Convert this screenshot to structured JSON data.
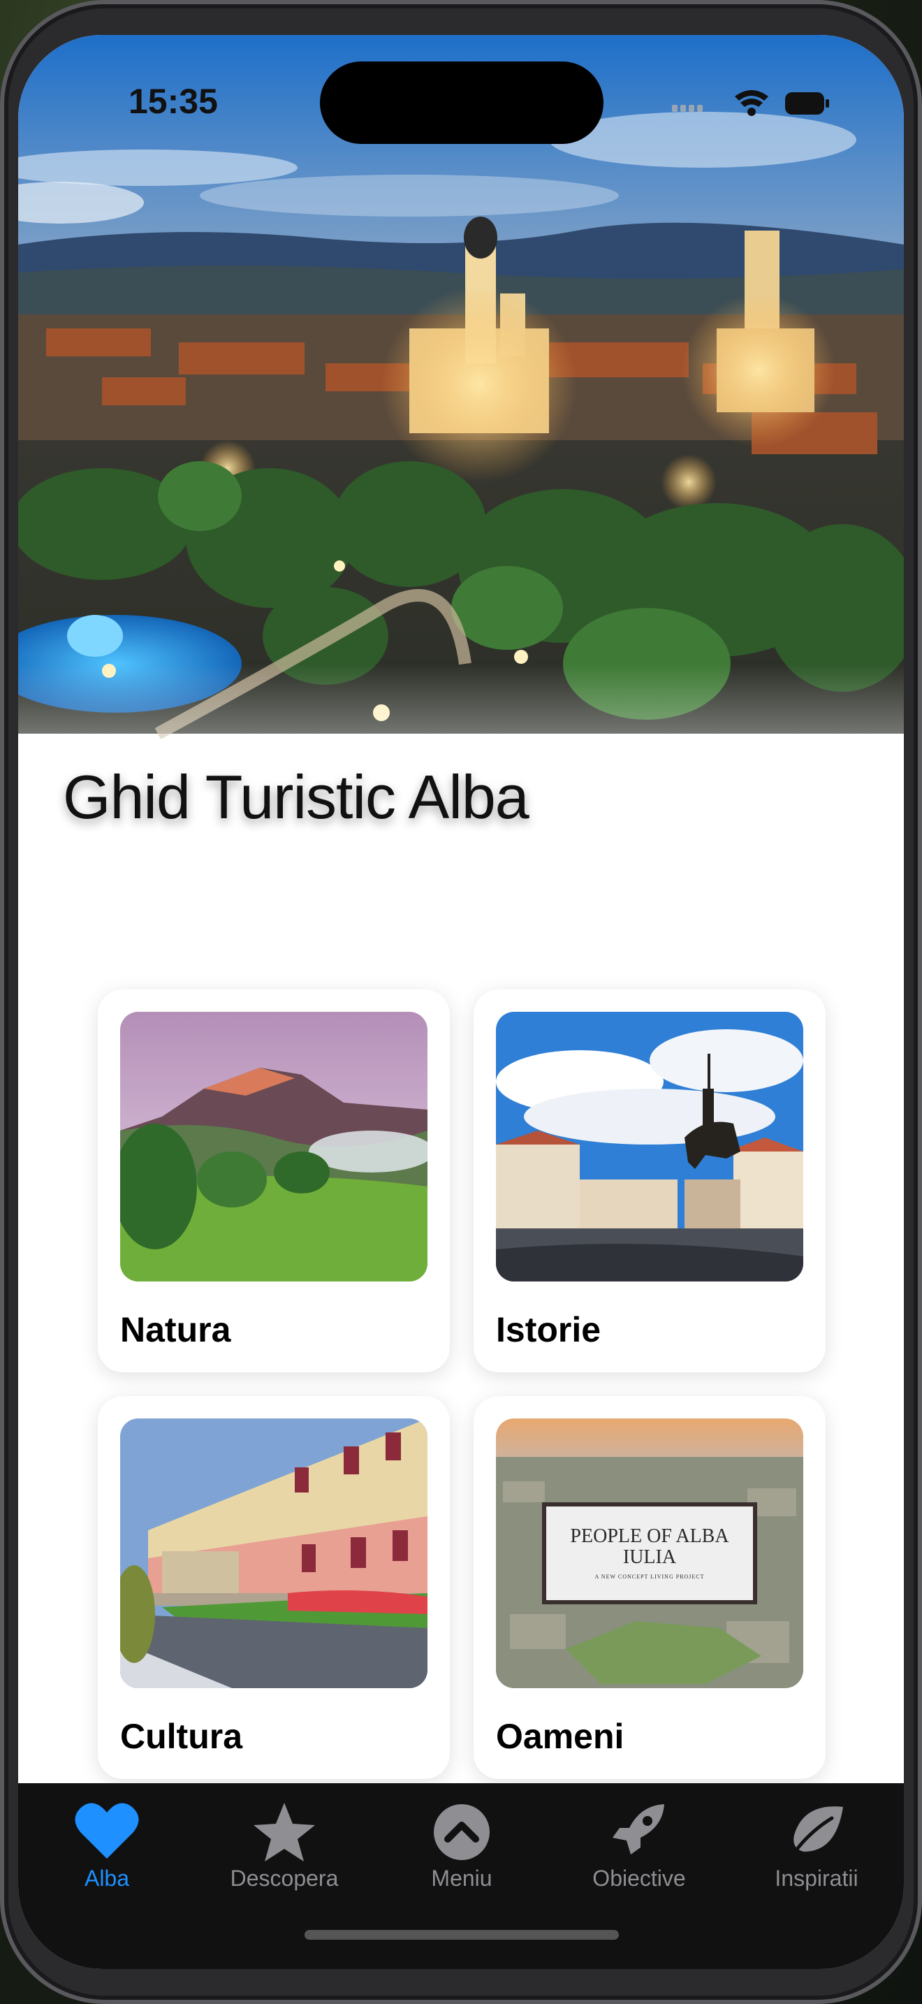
{
  "status_bar": {
    "time": "15:35"
  },
  "hero": {
    "title": "Ghid Turistic Alba"
  },
  "categories": [
    {
      "label": "Natura",
      "image": "mountain-meadow"
    },
    {
      "label": "Istorie",
      "image": "equestrian-statue"
    },
    {
      "label": "Cultura",
      "image": "palace-facade"
    },
    {
      "label": "Oameni",
      "image": "city-aerial-poster",
      "poster_title": "PEOPLE OF ALBA IULIA",
      "poster_subtitle": "A NEW CONCEPT LIVING PROJECT"
    }
  ],
  "tabs": [
    {
      "label": "Alba",
      "icon": "heart-icon",
      "active": true
    },
    {
      "label": "Descopera",
      "icon": "star-icon"
    },
    {
      "label": "Meniu",
      "icon": "chevron-up-circle-icon"
    },
    {
      "label": "Obiective",
      "icon": "rocket-icon"
    },
    {
      "label": "Inspiratii",
      "icon": "leaf-icon"
    }
  ],
  "colors": {
    "accent": "#1E90FF",
    "tab_inactive": "#8E8E93",
    "tabbar_bg": "#111111"
  }
}
